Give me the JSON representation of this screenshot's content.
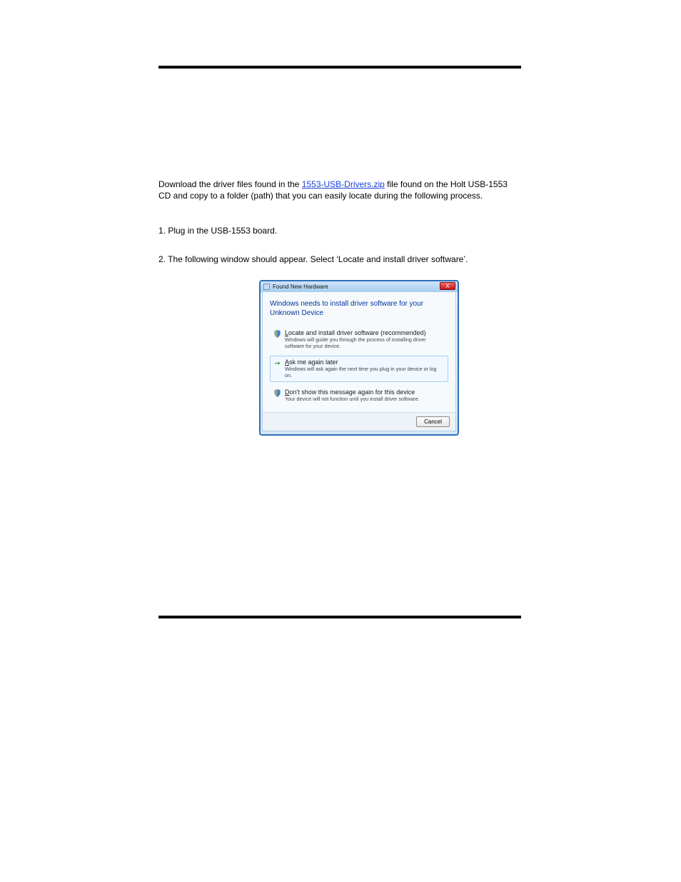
{
  "doc": {
    "intro_prefix": "Download the driver files found in the ",
    "intro_link_text": "1553-USB-Drivers.zip",
    "intro_suffix": " file found on the Holt USB-1553 CD and copy to a folder (path) that you can easily locate during the following process.",
    "step1": "1. Plug in the USB-1553 board.",
    "step2": "2. The following window should appear. Select ‘Locate and install driver software’."
  },
  "dialog": {
    "title": "Found New Hardware",
    "close_label": "X",
    "instruction": "Windows needs to install driver software for your Unknown Device",
    "options": [
      {
        "title_before": "",
        "title_underline": "L",
        "title_after": "ocate and install driver software (recommended)",
        "desc": "Windows will guide you through the process of installing driver software for your device.",
        "icon": "shield"
      },
      {
        "title_before": "",
        "title_underline": "A",
        "title_after": "sk me again later",
        "desc": "Windows will ask again the next time you plug in your device or log on.",
        "icon": "arrow"
      },
      {
        "title_before": "",
        "title_underline": "D",
        "title_after": "on't show this message again for this device",
        "desc": "Your device will not function until you install driver software.",
        "icon": "shield"
      }
    ],
    "cancel_label": "Cancel"
  }
}
